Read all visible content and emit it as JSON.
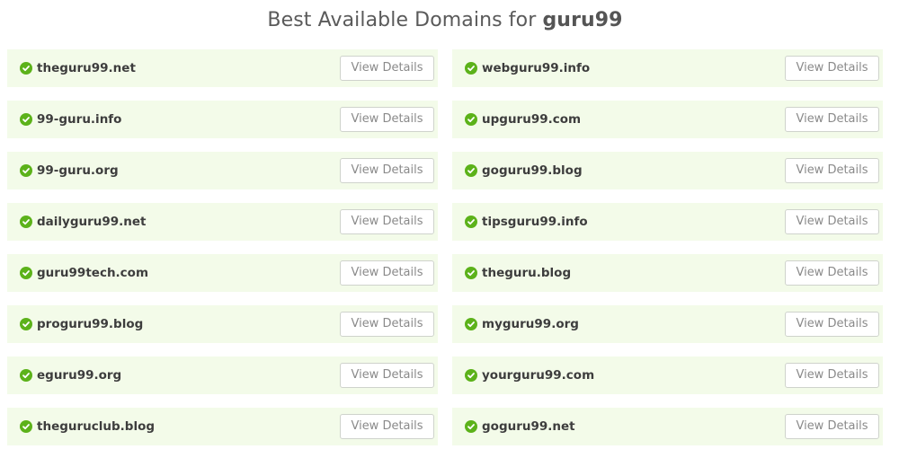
{
  "header": {
    "title_prefix": "Best Available Domains for ",
    "keyword": "guru99"
  },
  "domains": [
    {
      "name": "theguru99.net",
      "button_label": "View Details",
      "status_icon": "check-circle-icon"
    },
    {
      "name": "webguru99.info",
      "button_label": "View Details",
      "status_icon": "check-circle-icon"
    },
    {
      "name": "99-guru.info",
      "button_label": "View Details",
      "status_icon": "check-circle-icon"
    },
    {
      "name": "upguru99.com",
      "button_label": "View Details",
      "status_icon": "check-circle-icon"
    },
    {
      "name": "99-guru.org",
      "button_label": "View Details",
      "status_icon": "check-circle-icon"
    },
    {
      "name": "goguru99.blog",
      "button_label": "View Details",
      "status_icon": "check-circle-icon"
    },
    {
      "name": "dailyguru99.net",
      "button_label": "View Details",
      "status_icon": "check-circle-icon"
    },
    {
      "name": "tipsguru99.info",
      "button_label": "View Details",
      "status_icon": "check-circle-icon"
    },
    {
      "name": "guru99tech.com",
      "button_label": "View Details",
      "status_icon": "check-circle-icon"
    },
    {
      "name": "theguru.blog",
      "button_label": "View Details",
      "status_icon": "check-circle-icon"
    },
    {
      "name": "proguru99.blog",
      "button_label": "View Details",
      "status_icon": "check-circle-icon"
    },
    {
      "name": "myguru99.org",
      "button_label": "View Details",
      "status_icon": "check-circle-icon"
    },
    {
      "name": "eguru99.org",
      "button_label": "View Details",
      "status_icon": "check-circle-icon"
    },
    {
      "name": "yourguru99.com",
      "button_label": "View Details",
      "status_icon": "check-circle-icon"
    },
    {
      "name": "theguruclub.blog",
      "button_label": "View Details",
      "status_icon": "check-circle-icon"
    },
    {
      "name": "goguru99.net",
      "button_label": "View Details",
      "status_icon": "check-circle-icon"
    }
  ],
  "colors": {
    "card_background": "#f3fbe9",
    "check_green": "#5cb21a",
    "button_border": "#cfd3cc",
    "button_text": "#8a8a8a"
  }
}
